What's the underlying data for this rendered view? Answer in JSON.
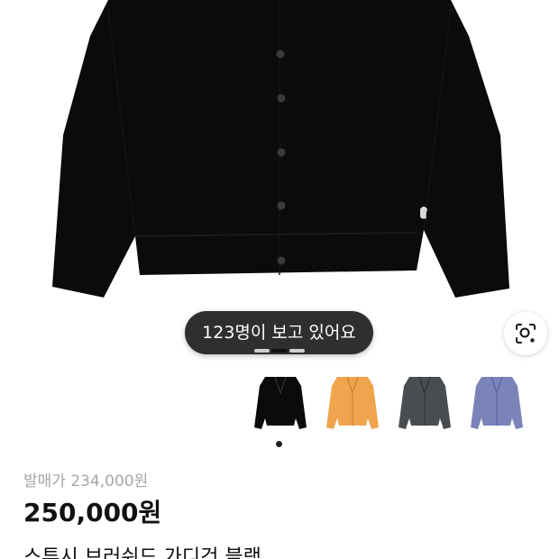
{
  "product": {
    "viewers_text": "123명이 보고 있어요",
    "list_price": "발매가 234,000원",
    "sale_price": "250,000원",
    "title": "스투시 브러쉬드 가디건 블랙"
  },
  "colors": {
    "pill_bg": "#2f2f2f",
    "black": "#0b0b0b",
    "orange": "#f0a44e",
    "charcoal": "#4a4d50",
    "lavender": "#7b84b8",
    "muted_text": "#a6a6a6"
  },
  "icons": {
    "lens": "lens-icon"
  },
  "carousel": {
    "current": 2,
    "total": 3
  },
  "thumbnails": [
    {
      "name": "black"
    },
    {
      "name": "orange"
    },
    {
      "name": "charcoal"
    },
    {
      "name": "lavender"
    }
  ]
}
